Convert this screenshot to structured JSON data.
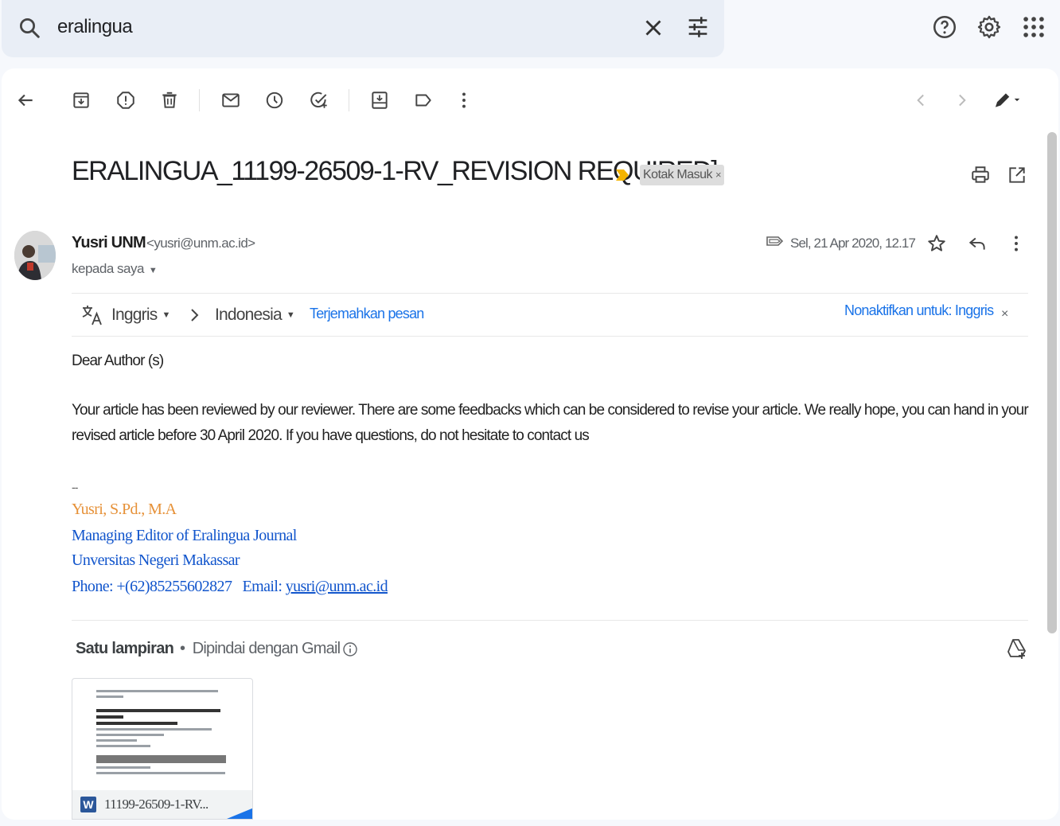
{
  "search": {
    "query": "eralingua"
  },
  "colors": {
    "accent": "#1a73e8",
    "signature_name": "#e69138",
    "signature_blue": "#1155cc",
    "important_marker": "#f4b400"
  },
  "toolbar": {
    "icons": [
      "back-arrow-icon",
      "archive-icon",
      "report-spam-icon",
      "delete-icon",
      "mark-unread-icon",
      "snooze-icon",
      "add-task-icon",
      "move-to-icon",
      "label-icon",
      "more-vert-icon",
      "prev-icon",
      "next-icon",
      "edit-icon"
    ]
  },
  "email": {
    "subject": "ERALINGUA_11199-26509-1-RV_REVISION REQUIRED]",
    "label": "Kotak Masuk",
    "label_close": "×",
    "sender_name": "Yusri UNM",
    "sender_email": "<yusri@unm.ac.id>",
    "recipient": "kepada saya",
    "date": "Sel, 21 Apr 2020, 12.17"
  },
  "translate": {
    "from": "Inggris",
    "to": "Indonesia",
    "action": "Terjemahkan pesan",
    "disable": "Nonaktifkan untuk: Inggris",
    "close": "×"
  },
  "body": {
    "greeting": "Dear Author (s)",
    "line1": "Your article has been reviewed by our reviewer. There are some feedbacks which can be considered  to revise your article. We really hope,  you can hand in your",
    "line2": "revised article before 30 April 2020.  If you have questions, do not hesitate to contact us",
    "sig_separator": "--"
  },
  "signature": {
    "name": "Yusri, S.Pd., M.A",
    "title": "Managing Editor of Eralingua Journal",
    "org": "Unversitas Negeri Makassar",
    "phone": "Phone: +(62)85255602827   Email: ",
    "email_link": "yusri@unm.ac.id"
  },
  "attachments": {
    "title": "Satu lampiran",
    "dot": "•",
    "scan": "Dipindai dengan Gmail",
    "file_name": "11199-26509-1-RV...",
    "file_type_letter": "W"
  }
}
